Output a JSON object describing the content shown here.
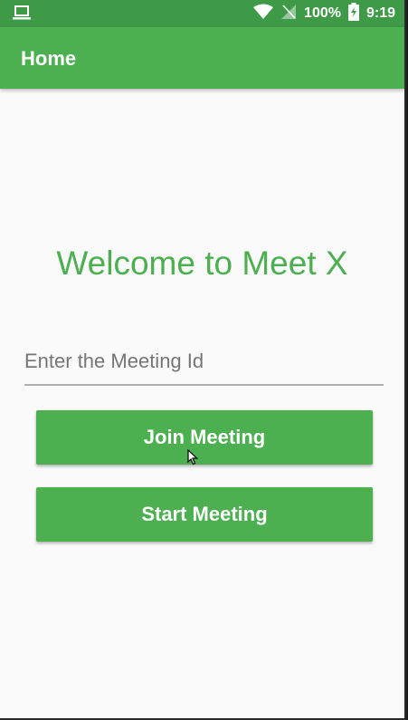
{
  "status_bar": {
    "battery": "100%",
    "time": "9:19",
    "icons": [
      "laptop-icon",
      "wifi-icon",
      "no-signal-icon",
      "battery-charging-icon"
    ]
  },
  "app_bar": {
    "title": "Home"
  },
  "main": {
    "welcome": "Welcome to Meet X",
    "meeting_id_placeholder": "Enter the Meeting Id",
    "meeting_id_value": "",
    "join_label": "Join Meeting",
    "start_label": "Start Meeting"
  },
  "colors": {
    "primary": "#4caf50",
    "status_bar": "#3e9a47",
    "background": "#fafafa"
  }
}
